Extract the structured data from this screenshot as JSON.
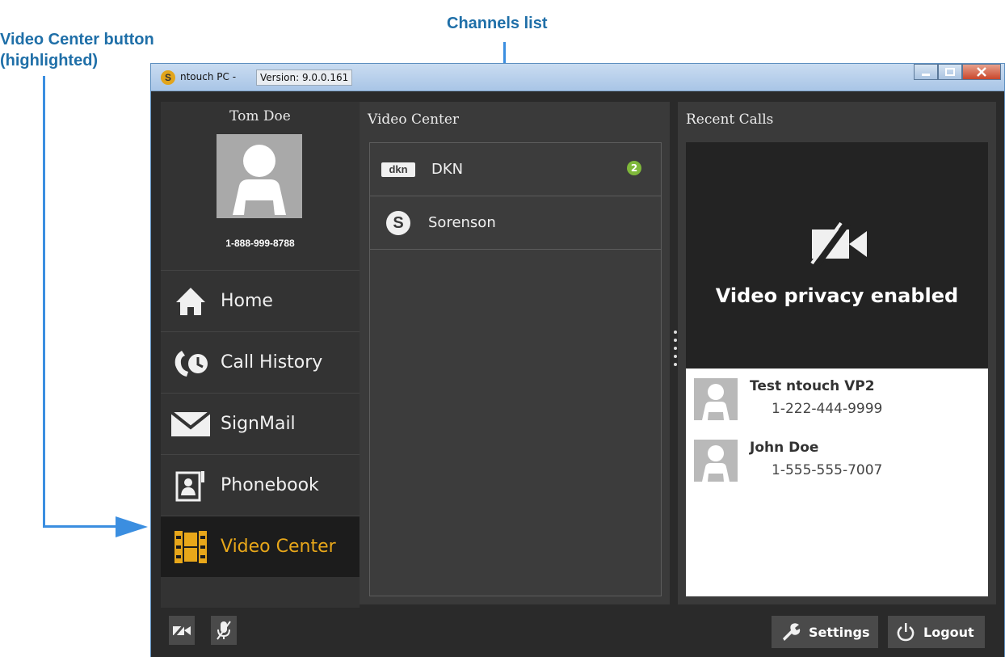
{
  "callouts": {
    "video_center_button": "Video Center button\n(highlighted)",
    "channels_list": "Channels list"
  },
  "window": {
    "app_name": "ntouch PC",
    "separator": "-",
    "version": "Version: 9.0.0.161"
  },
  "profile": {
    "name": "Tom Doe",
    "phone": "1-888-999-8788"
  },
  "nav": [
    {
      "label": "Home",
      "icon": "home-icon"
    },
    {
      "label": "Call History",
      "icon": "call-history-icon"
    },
    {
      "label": "SignMail",
      "icon": "envelope-icon"
    },
    {
      "label": "Phonebook",
      "icon": "phonebook-icon"
    },
    {
      "label": "Video Center",
      "icon": "film-icon",
      "active": true
    }
  ],
  "video_center": {
    "title": "Video Center",
    "channels": [
      {
        "logo": "dkn",
        "name": "DKN",
        "badge": "2"
      },
      {
        "logo": "S",
        "name": "Sorenson"
      }
    ]
  },
  "recent_calls": {
    "title": "Recent Calls",
    "privacy_text": "Video privacy enabled",
    "items": [
      {
        "name": "Test ntouch VP2",
        "phone": "1-222-444-9999"
      },
      {
        "name": "John Doe",
        "phone": "1-555-555-7007"
      }
    ]
  },
  "bottom": {
    "settings_label": "Settings",
    "logout_label": "Logout"
  },
  "colors": {
    "accent": "#e8a71a",
    "callout": "#1f6fa8",
    "arrow": "#3b8ee0",
    "badge": "#7fb83a"
  }
}
